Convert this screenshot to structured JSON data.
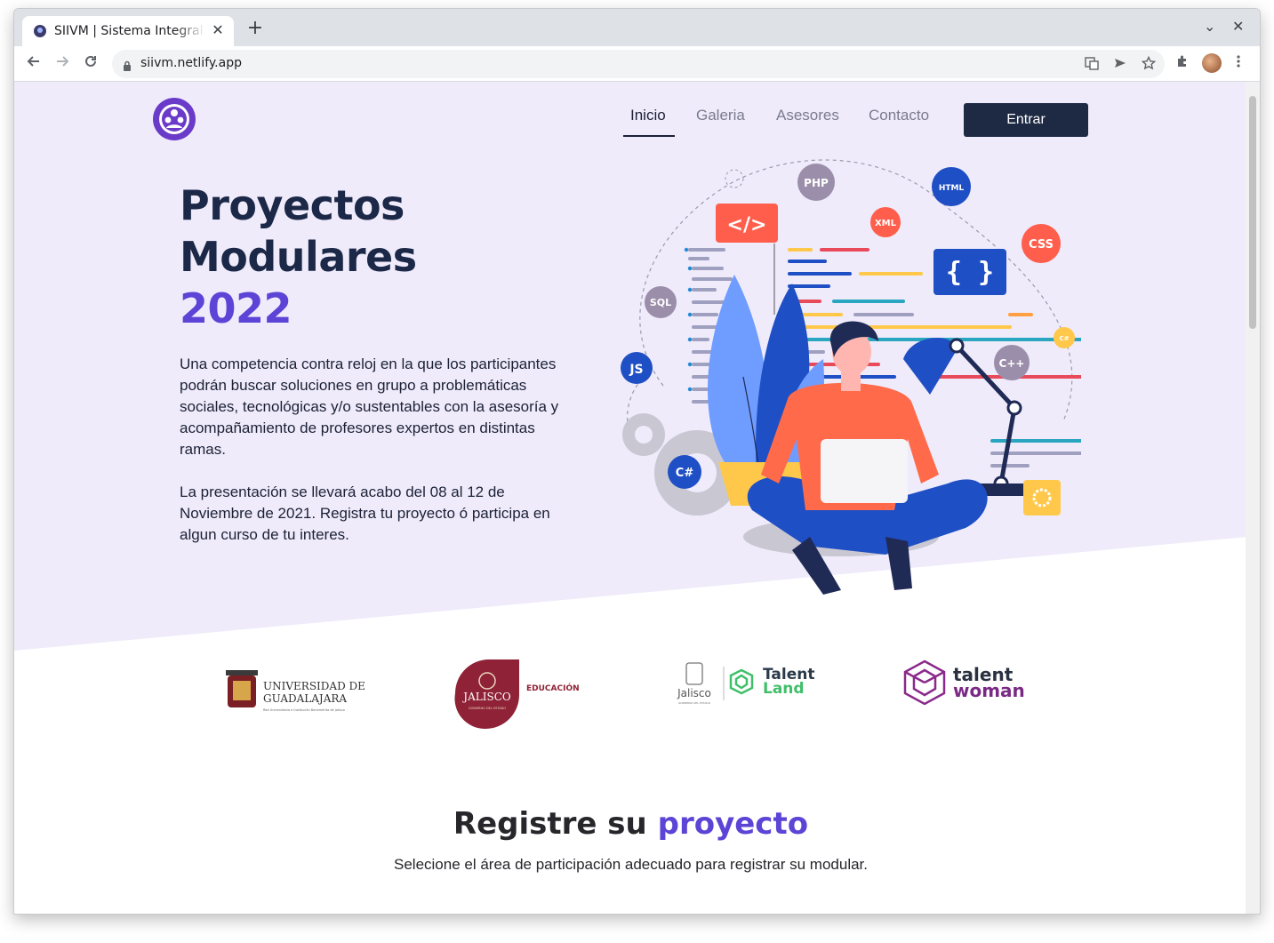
{
  "browser": {
    "tab_title": "SIIVM | Sistema Integral de",
    "tab_close": "✕",
    "new_tab": "+",
    "url": "siivm.netlify.app",
    "window_controls": {
      "minimize": "⌄",
      "close": "✕"
    }
  },
  "header": {
    "nav": [
      {
        "label": "Inicio",
        "active": true
      },
      {
        "label": "Galeria",
        "active": false
      },
      {
        "label": "Asesores",
        "active": false
      },
      {
        "label": "Contacto",
        "active": false
      }
    ],
    "cta_label": "Entrar"
  },
  "hero": {
    "title_line1": "Proyectos",
    "title_line2": "Modulares",
    "title_year": "2022",
    "paragraph1": "Una competencia contra reloj en la que los participantes podrán buscar soluciones en grupo a problemáticas sociales, tecnológicas y/o sustentables con la asesoría y acompañamiento de profesores expertos en distintas ramas.",
    "paragraph2": "La presentación se llevará acabo del 08 al 12 de Noviembre de 2021. Registra tu proyecto ó participa en algun curso de tu interes.",
    "illustration_badges": [
      "PHP",
      "HTML",
      "XML",
      "CSS",
      "SQL",
      "JS",
      "C++",
      "C#",
      "C#"
    ]
  },
  "partners": [
    {
      "line1": "UNIVERSIDAD DE",
      "line2": "GUADALAJARA",
      "line3": "Red Universitaria e Institución Benemérita de Jalisco"
    },
    {
      "seal": "JALISCO",
      "seal_sub": "GOBIERNO DEL ESTADO",
      "label": "EDUCACIÓN"
    },
    {
      "line1": "Jalisco",
      "line1_sub": "GOBIERNO DEL ESTADO",
      "line2": "Talent",
      "line3": "Land"
    },
    {
      "line1": "talent",
      "line2": "woman"
    }
  ],
  "register": {
    "title_prefix": "Registre su",
    "title_accent": "proyecto",
    "subtitle": "Selecione el área de participación adecuado para registrar su modular."
  },
  "colors": {
    "hero_bg": "#efebfb",
    "accent": "#5c44d6",
    "dark": "#1c2847",
    "button": "#1e2a44"
  }
}
